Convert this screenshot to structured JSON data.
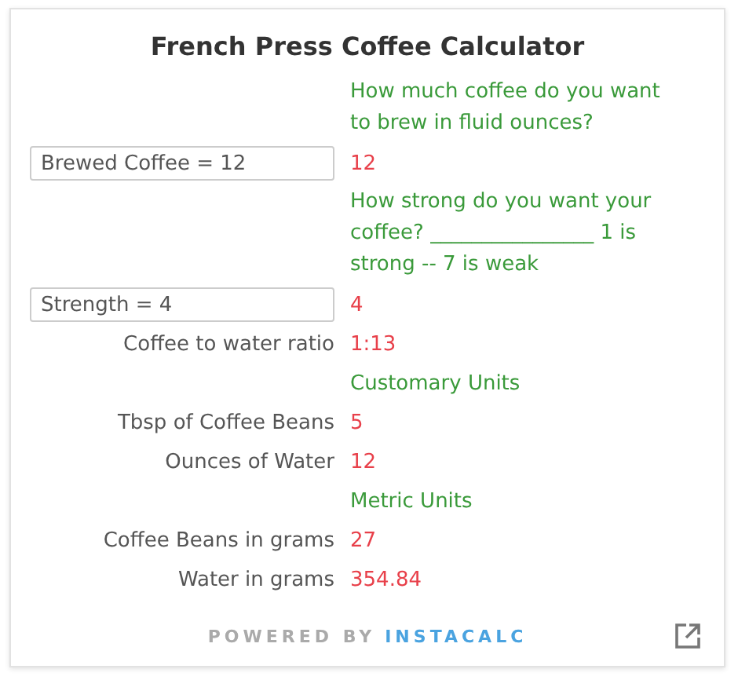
{
  "title": "French Press Coffee Calculator",
  "rows": [
    {
      "kind": "note",
      "text": "How much coffee do you want to brew in fluid ounces?"
    },
    {
      "kind": "input",
      "value": "Brewed Coffee = 12",
      "result": "12"
    },
    {
      "kind": "note",
      "text": "How strong do you want your coffee? ________________ 1 is strong -- 7 is weak"
    },
    {
      "kind": "input",
      "value": "Strength = 4",
      "result": "4"
    },
    {
      "kind": "output",
      "label": "Coffee to water ratio",
      "result": "1:13"
    },
    {
      "kind": "note",
      "text": "Customary Units"
    },
    {
      "kind": "output",
      "label": "Tbsp of Coffee Beans",
      "result": "5"
    },
    {
      "kind": "output",
      "label": "Ounces of Water",
      "result": "12"
    },
    {
      "kind": "note",
      "text": "Metric Units"
    },
    {
      "kind": "output",
      "label": "Coffee Beans in grams",
      "result": "27"
    },
    {
      "kind": "output",
      "label": "Water in grams",
      "result": "354.84"
    }
  ],
  "footer": {
    "prefix": "POWERED BY",
    "brand": "INSTACALC"
  }
}
